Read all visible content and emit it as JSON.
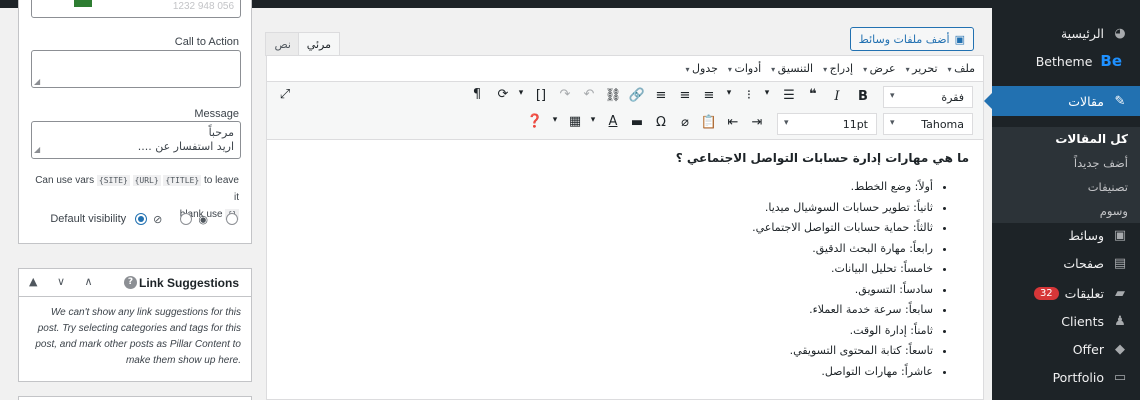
{
  "admin_menu": {
    "items": [
      {
        "label": "الرئيسية",
        "icon": "dashboard-icon"
      },
      {
        "label": "Betheme",
        "icon": "be-logo",
        "badge": "Be"
      },
      {
        "label": "مقالات",
        "icon": "pin-icon"
      },
      {
        "label": "وسائط",
        "icon": "media-icon"
      },
      {
        "label": "صفحات",
        "icon": "page-icon"
      },
      {
        "label": "تعليقات",
        "icon": "comment-icon",
        "count": "32"
      },
      {
        "label": "Clients",
        "icon": "clients-icon"
      },
      {
        "label": "Offer",
        "icon": "tag-icon"
      },
      {
        "label": "Portfolio",
        "icon": "folder-icon"
      }
    ],
    "submenu": [
      "كل المقالات",
      "أضف جديداً",
      "تصنيفات",
      "وسوم"
    ]
  },
  "sidebar": {
    "phone_placeholder": "1232 948 056",
    "cta_label": "Call to Action",
    "message_label": "Message",
    "message_value": [
      "مرحباً",
      "اريد استفسار عن ...."
    ],
    "vars_note": {
      "prefix": "Can use vars",
      "vars": [
        "{SITE}",
        "{URL}",
        "{TITLE}"
      ],
      "suffix": "to leave it",
      "line2": "blank use",
      "blank": "{}"
    },
    "visibility_label": "Default visibility",
    "link_suggestions_title": "Link Suggestions",
    "link_suggestions_text": "We can't show any link suggestions for this post. Try selecting categories and tags for this post, and mark other posts as Pillar Content to make them show up here."
  },
  "editor": {
    "add_media": "أضف ملفات وسائط",
    "tabs": {
      "visual": "مرئي",
      "text": "نص"
    },
    "menubar": [
      "ملف",
      "تحرير",
      "عرض",
      "إدراج",
      "التنسيق",
      "أدوات",
      "جدول"
    ],
    "format_select": "فقرة",
    "font_family": "Tahoma",
    "font_size": "11pt",
    "heading": "ما هي مهارات إدارة حسابات التواصل الاجتماعي ؟",
    "list": [
      "أولاً: وضع الخطط.",
      "ثانياً: تطوير حسابات  السوشيال ميديا.",
      "ثالثاً: حماية حسابات التواصل الاجتماعي.",
      "رابعاً: مهارة البحث الدقيق.",
      "خامساً: تحليل البيانات.",
      "سادساً: التسويق.",
      "سابعاً: سرعة خدمة العملاء.",
      "ثامناً: إدارة الوقت.",
      "تاسعاً: كتابة المحتوى التسويقي.",
      "عاشراً: مهارات التواصل."
    ]
  }
}
